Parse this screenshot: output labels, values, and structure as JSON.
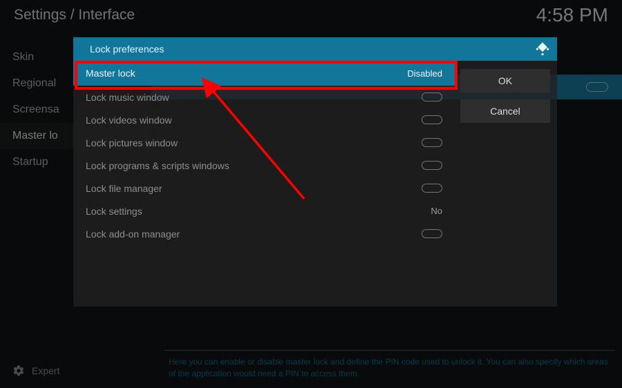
{
  "breadcrumb": "Settings / Interface",
  "clock": "4:58 PM",
  "sidebar": {
    "items": [
      {
        "label": "Skin"
      },
      {
        "label": "Regional"
      },
      {
        "label": "Screensaver"
      },
      {
        "label": "Master lock"
      },
      {
        "label": "Startup"
      }
    ],
    "activeIndex": 3
  },
  "footer_mode": "Expert",
  "help_text": "Here you can enable or disable master lock and define the PIN code used to unlock it. You can also specify which areas of the application would need a PIN to access them.",
  "dialog": {
    "title": "Lock preferences",
    "ok": "OK",
    "cancel": "Cancel",
    "rows": [
      {
        "label": "Master lock",
        "kind": "value",
        "value": "Disabled",
        "highlight": true
      },
      {
        "label": "Lock music window",
        "kind": "toggle",
        "on": false
      },
      {
        "label": "Lock videos window",
        "kind": "toggle",
        "on": false
      },
      {
        "label": "Lock pictures window",
        "kind": "toggle",
        "on": false
      },
      {
        "label": "Lock programs & scripts windows",
        "kind": "toggle",
        "on": false
      },
      {
        "label": "Lock file manager",
        "kind": "toggle",
        "on": false
      },
      {
        "label": "Lock settings",
        "kind": "value",
        "value": "No"
      },
      {
        "label": "Lock add-on manager",
        "kind": "toggle",
        "on": false
      }
    ]
  },
  "colors": {
    "accent": "#12759a",
    "red": "#f00"
  }
}
